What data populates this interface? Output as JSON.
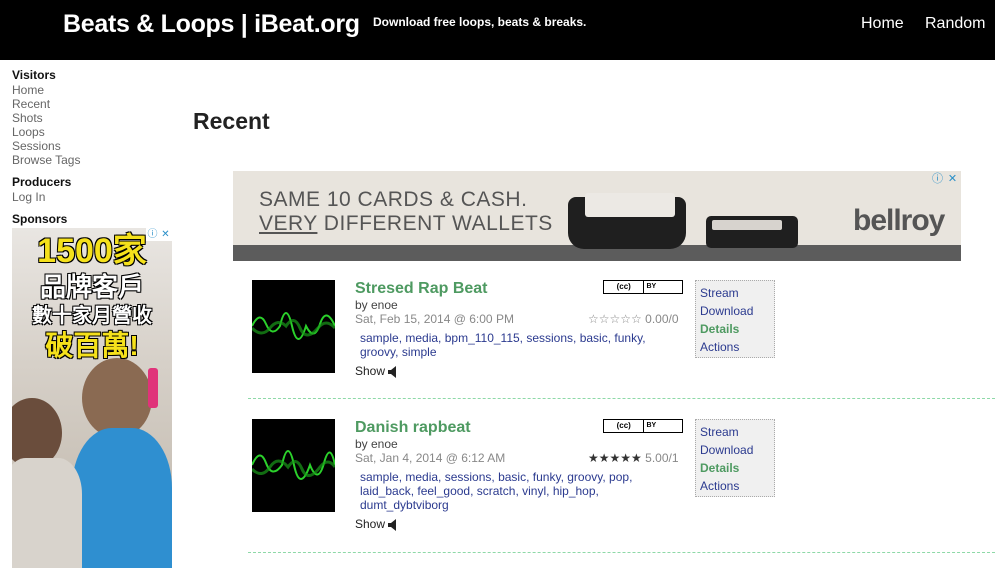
{
  "header": {
    "site_title": "Beats & Loops | iBeat.org",
    "tagline": "Download free loops, beats & breaks.",
    "nav": [
      "Home",
      "Random"
    ]
  },
  "sidebar": {
    "visitors_heading": "Visitors",
    "visitors_links": [
      "Home",
      "Recent",
      "Shots",
      "Loops",
      "Sessions",
      "Browse Tags"
    ],
    "producers_heading": "Producers",
    "producers_links": [
      "Log In"
    ],
    "sponsors_heading": "Sponsors"
  },
  "side_ad": {
    "line1": "1500家",
    "line2": "品牌客戶",
    "line3": "數十家月營收",
    "line4": "破百萬!"
  },
  "main": {
    "title": "Recent"
  },
  "banner_ad": {
    "line1": "SAME 10 CARDS & CASH.",
    "line2_underlined": "VERY",
    "line2_rest": " DIFFERENT WALLETS",
    "brand": "bellroy"
  },
  "loops": [
    {
      "title": "Stresed Rap Beat",
      "by": "by enoe",
      "date": "Sat, Feb 15, 2014 @ 6:00 PM",
      "stars": "☆☆☆☆☆",
      "score": "0.00/0",
      "license_left": "(cc)",
      "license_right": "BY",
      "tags": [
        "sample",
        "media",
        "bpm_110_115",
        "sessions",
        "basic",
        "funky",
        "groovy",
        "simple"
      ],
      "show_label": "Show",
      "actions": [
        "Stream",
        "Download",
        "Details",
        "Actions"
      ]
    },
    {
      "title": "Danish rapbeat",
      "by": "by enoe",
      "date": "Sat, Jan 4, 2014 @ 6:12 AM",
      "stars": "★★★★★",
      "score": "5.00/1",
      "license_left": "(cc)",
      "license_right": "BY",
      "tags": [
        "sample",
        "media",
        "sessions",
        "basic",
        "funky",
        "groovy",
        "pop",
        "laid_back",
        "feel_good",
        "scratch",
        "vinyl",
        "hip_hop",
        "dumt_dybtviborg"
      ],
      "show_label": "Show",
      "actions": [
        "Stream",
        "Download",
        "Details",
        "Actions"
      ]
    }
  ],
  "colors": {
    "header_bg": "#000000",
    "title_green": "#4e9a61",
    "link_blue": "#2b3a8f",
    "separator": "#8ed9a8"
  },
  "icons": {
    "ad_info": "info-icon",
    "ad_close": "close-icon",
    "speaker": "speaker-icon",
    "waveform": "waveform-icon"
  }
}
